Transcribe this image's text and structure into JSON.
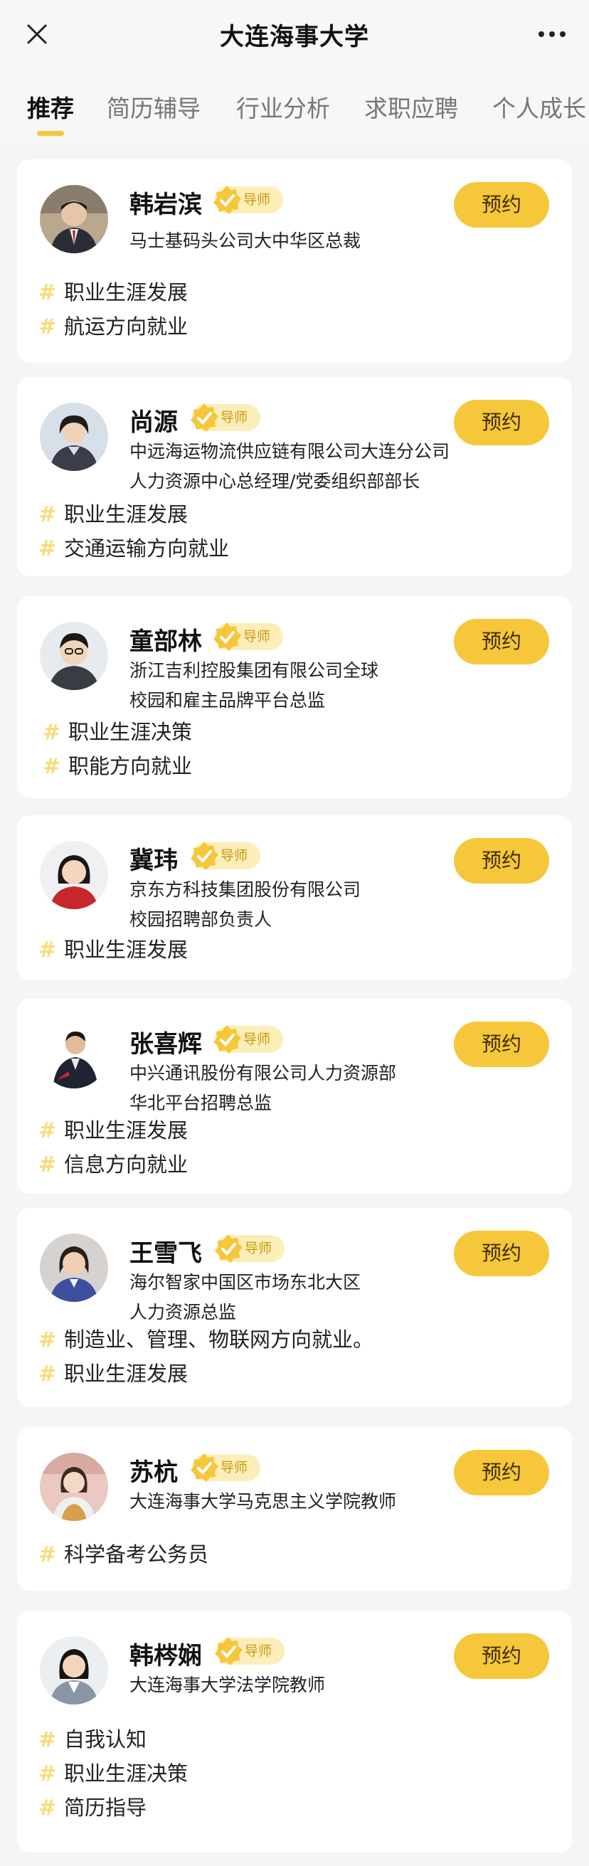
{
  "header": {
    "title": "大连海事大学"
  },
  "tabs": [
    {
      "label": "推荐"
    },
    {
      "label": "简历辅导"
    },
    {
      "label": "行业分析"
    },
    {
      "label": "求职应聘"
    },
    {
      "label": "个人成长"
    }
  ],
  "badge_label": "导师",
  "book_label": "预约",
  "mentors": [
    {
      "name": "韩岩滨",
      "desc": [
        "马士基码头公司大中华区总裁"
      ],
      "tags": [
        "职业生涯发展",
        "航运方向就业"
      ]
    },
    {
      "name": "尚源",
      "desc": [
        "中远海运物流供应链有限公司大连分公司",
        "人力资源中心总经理/党委组织部部长"
      ],
      "tags": [
        "职业生涯发展",
        "交通运输方向就业"
      ]
    },
    {
      "name": "童部林",
      "desc": [
        "浙江吉利控股集团有限公司全球",
        "校园和雇主品牌平台总监"
      ],
      "tags": [
        "职业生涯决策",
        "职能方向就业"
      ]
    },
    {
      "name": "冀玮",
      "desc": [
        "京东方科技集团股份有限公司",
        "校园招聘部负责人"
      ],
      "tags": [
        "职业生涯发展"
      ]
    },
    {
      "name": "张喜辉",
      "desc": [
        "中兴通讯股份有限公司人力资源部",
        "华北平台招聘总监"
      ],
      "tags": [
        "职业生涯发展",
        "信息方向就业"
      ]
    },
    {
      "name": "王雪飞",
      "desc": [
        "海尔智家中国区市场东北大区",
        "人力资源总监"
      ],
      "tags": [
        "制造业、管理、物联网方向就业。",
        "职业生涯发展"
      ]
    },
    {
      "name": "苏杭",
      "desc": [
        "大连海事大学马克思主义学院教师"
      ],
      "tags": [
        "科学备考公务员"
      ]
    },
    {
      "name": "韩梣娴",
      "desc": [
        "大连海事大学法学院教师"
      ],
      "tags": [
        "自我认知",
        "职业生涯决策",
        "简历指导"
      ]
    }
  ],
  "colors": {
    "accent": "#f6c73a",
    "badge_bg": "#fbeeb8",
    "badge_text": "#c99a10",
    "hash": "#f8dc7c"
  }
}
